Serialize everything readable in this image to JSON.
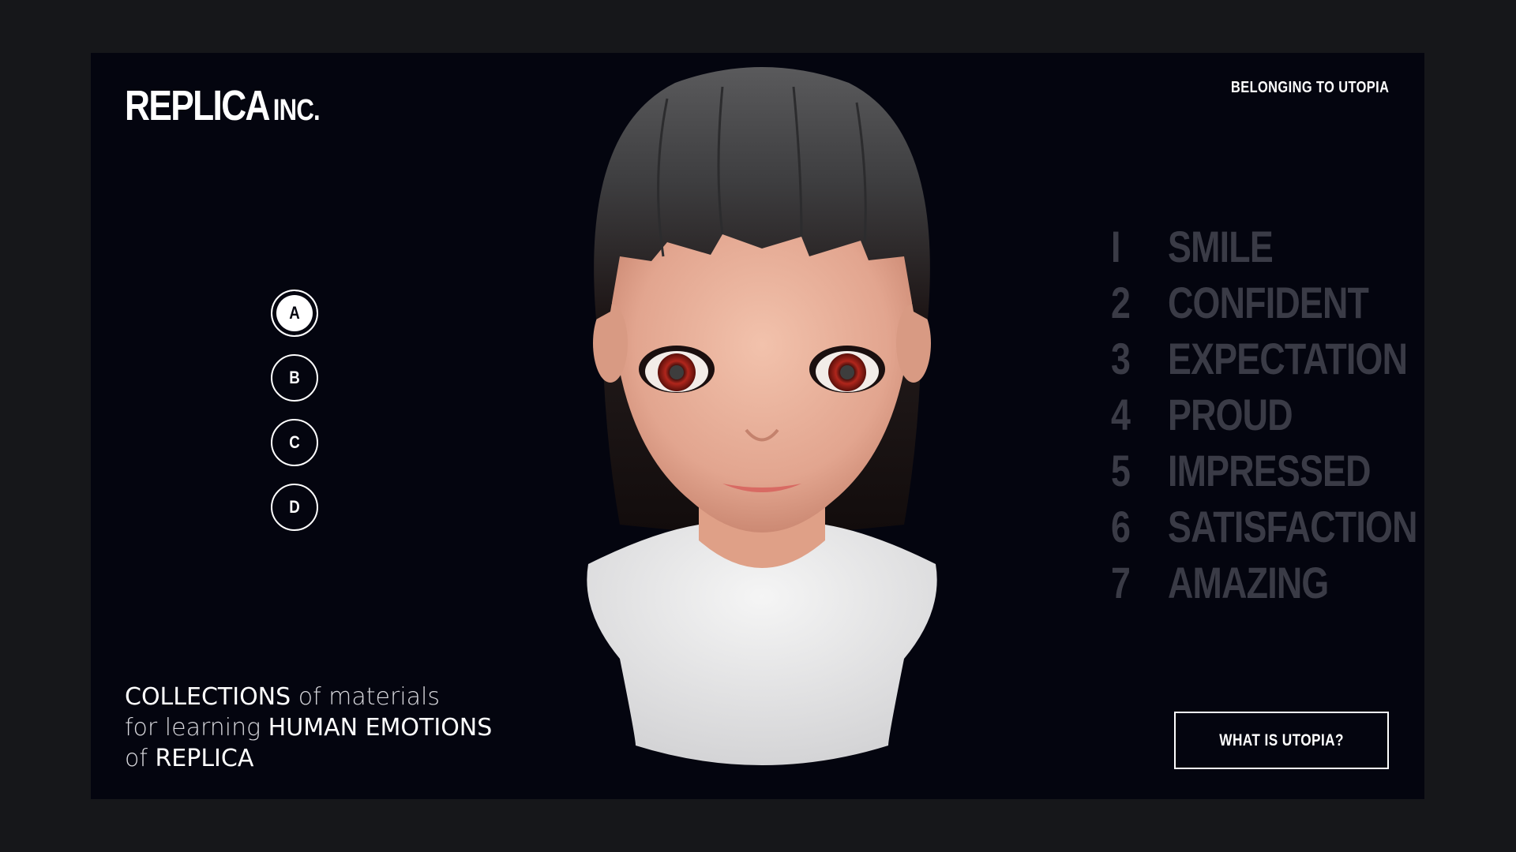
{
  "brand": {
    "name": "REPLICA",
    "suffix": "INC."
  },
  "nav": {
    "top_link": "BELONGING TO UTOPIA"
  },
  "selectors": [
    "A",
    "B",
    "C",
    "D"
  ],
  "selected": "A",
  "emotions": [
    {
      "num": "I",
      "label": "SMILE"
    },
    {
      "num": "2",
      "label": "CONFIDENT"
    },
    {
      "num": "3",
      "label": "EXPECTATION"
    },
    {
      "num": "4",
      "label": "PROUD"
    },
    {
      "num": "5",
      "label": "IMPRESSED"
    },
    {
      "num": "6",
      "label": "SATISFACTION"
    },
    {
      "num": "7",
      "label": "AMAZING"
    }
  ],
  "tagline": {
    "l1_strong": "COLLECTIONS",
    "l1_thin": " of materials",
    "l2_thin": "for learning ",
    "l2_strong": "HUMAN EMOTIONS",
    "l3_thin": "of ",
    "l3_strong": "REPLICA"
  },
  "cta": {
    "label": "WHAT IS UTOPIA?"
  },
  "colors": {
    "background": "#04050f",
    "outer": "#16171a",
    "emotion_text": "#3a3b46",
    "accent": "#ffffff"
  }
}
